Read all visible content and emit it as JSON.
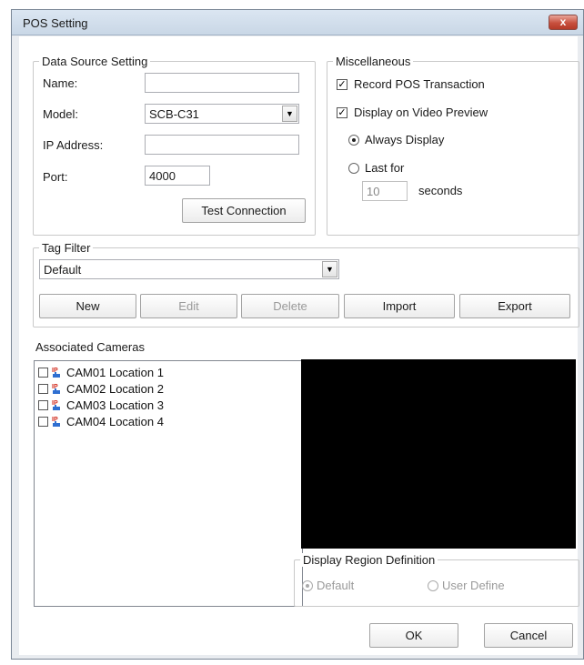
{
  "window": {
    "title": "POS Setting",
    "close_label": "x"
  },
  "data_source": {
    "legend": "Data Source Setting",
    "name_label": "Name:",
    "name_value": "",
    "model_label": "Model:",
    "model_value": "SCB-C31",
    "ip_label": "IP Address:",
    "ip_value": "",
    "port_label": "Port:",
    "port_value": "4000",
    "test_connection": "Test Connection"
  },
  "misc": {
    "legend": "Miscellaneous",
    "record_pos": {
      "label": "Record POS Transaction",
      "checked": true
    },
    "display_preview": {
      "label": "Display on Video Preview",
      "checked": true
    },
    "always_display": "Always Display",
    "last_for": "Last for",
    "seconds_value": "10",
    "seconds_label": "seconds"
  },
  "tag_filter": {
    "legend": "Tag Filter",
    "selected": "Default",
    "buttons": {
      "new": "New",
      "edit": "Edit",
      "delete": "Delete",
      "import": "Import",
      "export": "Export"
    }
  },
  "cameras": {
    "label": "Associated Cameras",
    "items": [
      {
        "name": "CAM01 Location 1"
      },
      {
        "name": "CAM02 Location 2"
      },
      {
        "name": "CAM03 Location 3"
      },
      {
        "name": "CAM04 Location 4"
      }
    ]
  },
  "region": {
    "legend": "Display Region Definition",
    "default_label": "Default",
    "user_define_label": "User Define"
  },
  "footer": {
    "ok": "OK",
    "cancel": "Cancel"
  },
  "colors": {
    "close_red": "#c8503e",
    "preview_bg": "#000000"
  }
}
